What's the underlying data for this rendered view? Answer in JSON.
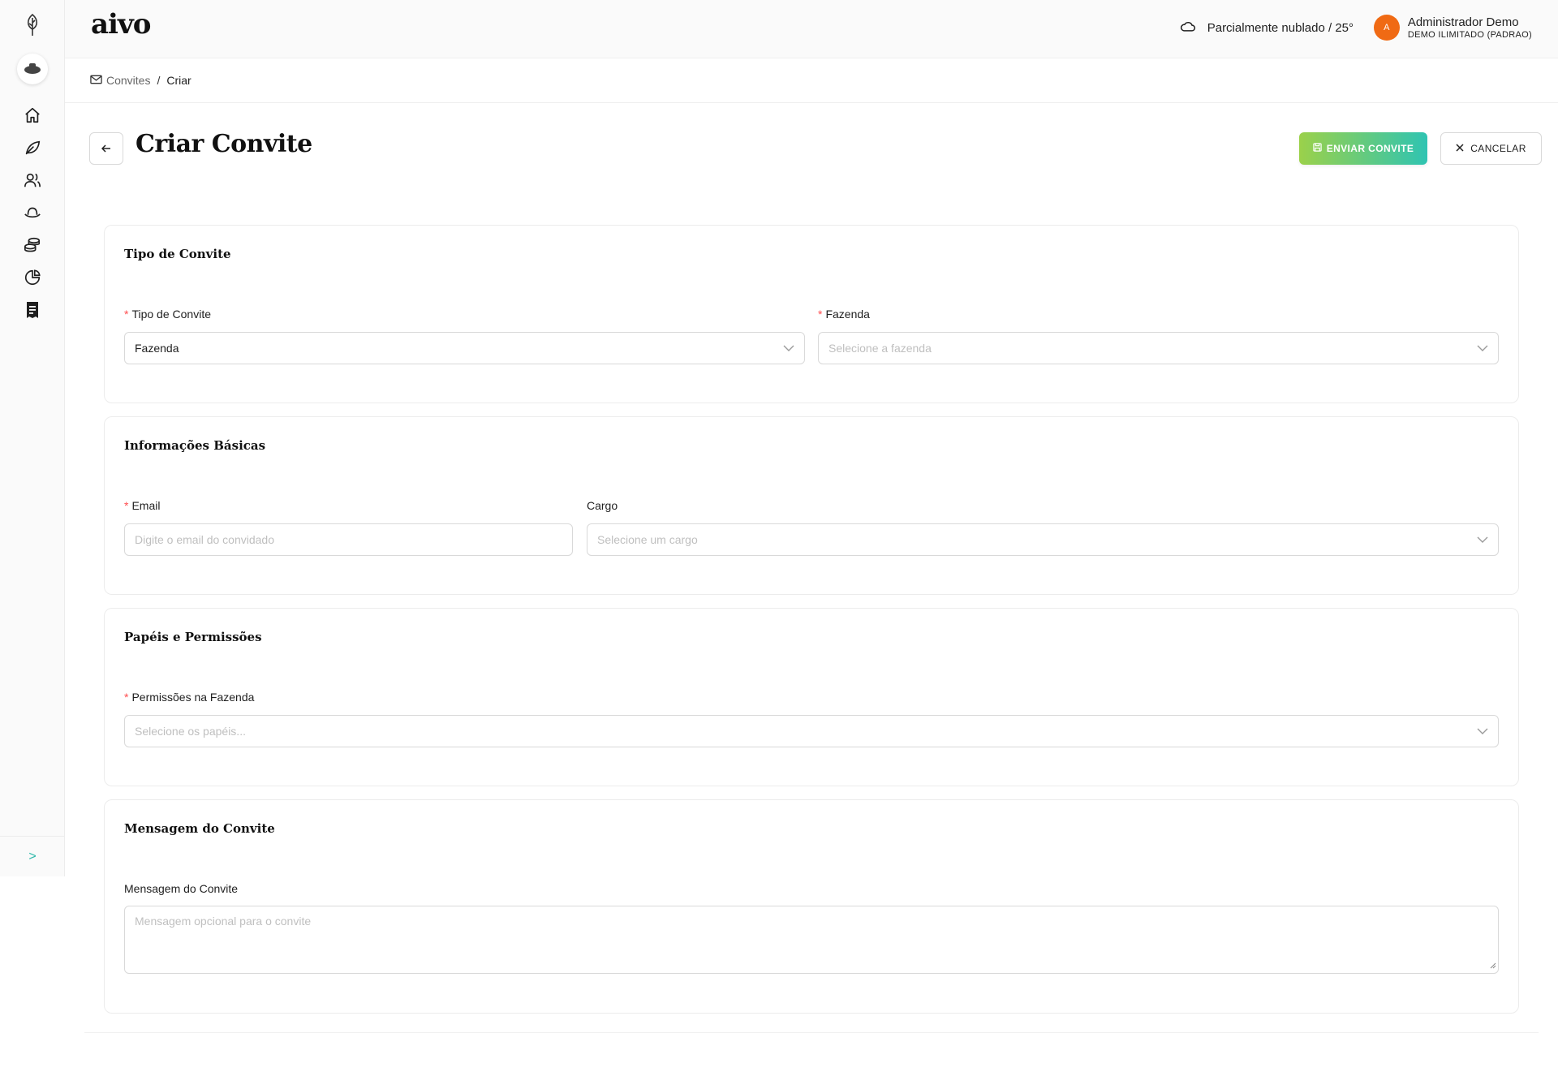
{
  "app": {
    "brand": "aivo"
  },
  "header": {
    "weather_text": "Parcialmente nublado / 25°",
    "user_initial": "A",
    "user_name": "Administrador Demo",
    "user_plan": "DEMO ILIMITADO (PADRAO)"
  },
  "sidebar": {
    "items": [
      {
        "icon": "home-icon"
      },
      {
        "icon": "leaf-icon"
      },
      {
        "icon": "users-icon"
      },
      {
        "icon": "hat-icon"
      },
      {
        "icon": "coins-icon"
      },
      {
        "icon": "pie-chart-icon"
      },
      {
        "icon": "receipt-icon"
      }
    ],
    "collapse_label": ">"
  },
  "breadcrumb": {
    "parent": "Convites",
    "separator": "/",
    "current": "Criar"
  },
  "page": {
    "title": "Criar Convite",
    "send_label": "ENVIAR CONVITE",
    "cancel_label": "CANCELAR"
  },
  "sections": {
    "tipo": {
      "title": "Tipo de Convite",
      "tipo_label": "Tipo de Convite",
      "tipo_value": "Fazenda",
      "fazenda_label": "Fazenda",
      "fazenda_placeholder": "Selecione a fazenda"
    },
    "basicas": {
      "title": "Informações Básicas",
      "email_label": "Email",
      "email_placeholder": "Digite o email do convidado",
      "cargo_label": "Cargo",
      "cargo_placeholder": "Selecione um cargo"
    },
    "papeis": {
      "title": "Papéis e Permissões",
      "perm_label": "Permissões na Fazenda",
      "perm_placeholder": "Selecione os papéis..."
    },
    "mensagem": {
      "title": "Mensagem do Convite",
      "msg_label": "Mensagem do Convite",
      "msg_placeholder": "Mensagem opcional para o convite"
    }
  },
  "required_mark": "*",
  "colors": {
    "accent_start": "#9bd14a",
    "accent_end": "#2fc4b2",
    "avatar": "#f06a14",
    "required": "#ff4d4f"
  }
}
